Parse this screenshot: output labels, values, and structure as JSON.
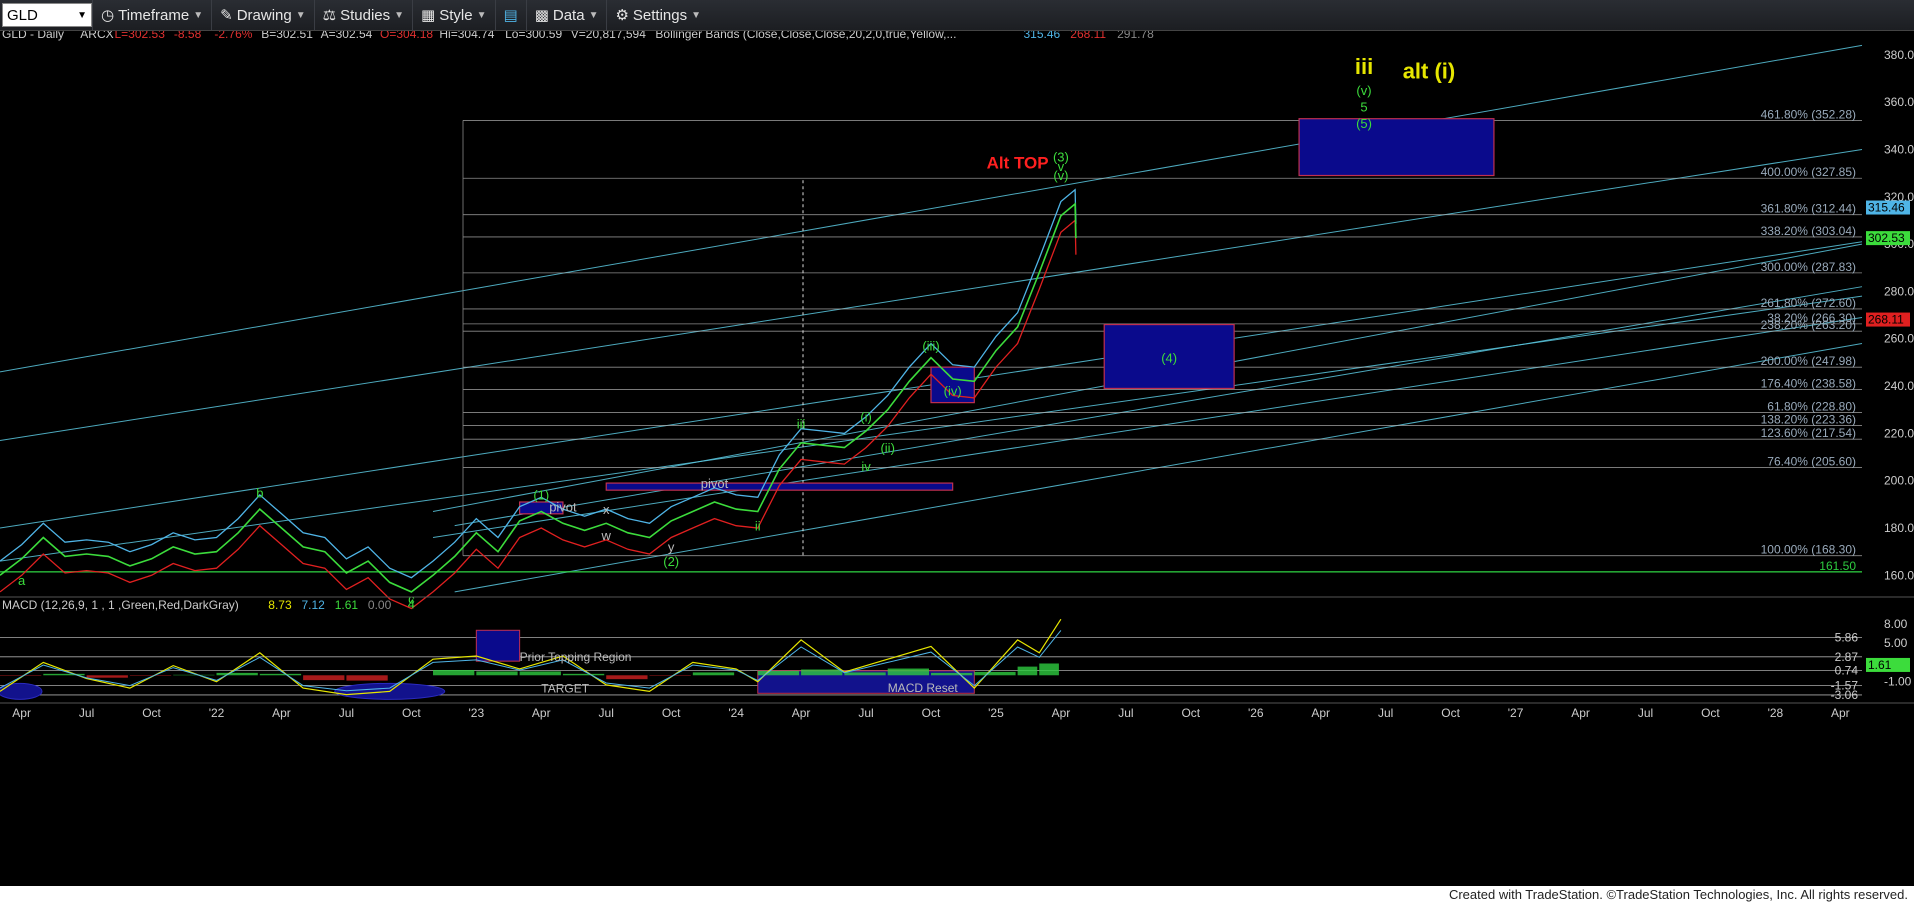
{
  "toolbar": {
    "symbol": "GLD",
    "timeframe": "Timeframe",
    "drawing": "Drawing",
    "studies": "Studies",
    "style": "Style",
    "data": "Data",
    "settings": "Settings"
  },
  "header": {
    "name": "GLD - Daily",
    "exchange": "ARCX",
    "last": "L=302.53",
    "change": "-8.58",
    "pct": "-2.76%",
    "bid": "B=302.51",
    "ask": "A=302.54",
    "open": "O=304.18",
    "high": "Hi=304.74",
    "low": "Lo=300.59",
    "volume": "V=20,817,594",
    "study": "Bollinger Bands (Close,Close,Close,20,2,0,true,Yellow,...",
    "bb_upper": "315.46",
    "bb_lower": "268.11",
    "bb_mid": "291.78"
  },
  "macd_header": {
    "label": "MACD (12,26,9, 1 , 1 ,Green,Red,DarkGray)",
    "v1": "8.73",
    "v2": "7.12",
    "v3": "1.61",
    "v4": "0.00"
  },
  "footer": "Created with TradeStation. ©TradeStation Technologies, Inc. All rights reserved.",
  "colors": {
    "price": "#3cdc3c",
    "bb_upper": "#4fb4e6",
    "bb_lower": "#e02020",
    "channel": "#5bc8e0",
    "fib": "#b0b0b0",
    "box": "#0a0a8c",
    "wave_green": "#3cdc3c",
    "wave_yellow": "#e6e600",
    "alt_top": "#ff2020"
  },
  "chart_data": {
    "type": "line",
    "symbol": "GLD",
    "price_axis": {
      "ylim": [
        150,
        385
      ],
      "ticks": [
        160,
        180,
        200,
        220,
        240,
        260,
        280,
        300,
        320,
        340,
        360,
        380
      ]
    },
    "time_axis": {
      "labels": [
        "Apr",
        "Jul",
        "Oct",
        "'22",
        "Apr",
        "Jul",
        "Oct",
        "'23",
        "Apr",
        "Jul",
        "Oct",
        "'24",
        "Apr",
        "Jul",
        "Oct",
        "'25",
        "Apr",
        "Jul",
        "Oct",
        "'26",
        "Apr",
        "Jul",
        "Oct",
        "'27",
        "Apr",
        "Jul",
        "Oct",
        "'28",
        "Apr"
      ],
      "start": "2021-03",
      "end": "2028-05"
    },
    "price_series": [
      [
        "2021-03",
        160
      ],
      [
        "2021-04",
        167
      ],
      [
        "2021-05",
        176
      ],
      [
        "2021-06",
        168
      ],
      [
        "2021-07",
        169
      ],
      [
        "2021-08",
        168
      ],
      [
        "2021-09",
        164
      ],
      [
        "2021-10",
        167
      ],
      [
        "2021-11",
        172
      ],
      [
        "2021-12",
        169
      ],
      [
        "2022-01",
        170
      ],
      [
        "2022-02",
        178
      ],
      [
        "2022-03",
        188
      ],
      [
        "2022-04",
        180
      ],
      [
        "2022-05",
        172
      ],
      [
        "2022-06",
        170
      ],
      [
        "2022-07",
        161
      ],
      [
        "2022-08",
        166
      ],
      [
        "2022-09",
        157
      ],
      [
        "2022-10",
        153
      ],
      [
        "2022-11",
        160
      ],
      [
        "2022-12",
        168
      ],
      [
        "2023-01",
        178
      ],
      [
        "2023-02",
        170
      ],
      [
        "2023-03",
        183
      ],
      [
        "2023-04",
        187
      ],
      [
        "2023-05",
        182
      ],
      [
        "2023-06",
        179
      ],
      [
        "2023-07",
        182
      ],
      [
        "2023-08",
        178
      ],
      [
        "2023-09",
        176
      ],
      [
        "2023-10",
        183
      ],
      [
        "2023-11",
        187
      ],
      [
        "2023-12",
        191
      ],
      [
        "2024-01",
        188
      ],
      [
        "2024-02",
        187
      ],
      [
        "2024-03",
        205
      ],
      [
        "2024-04",
        216
      ],
      [
        "2024-05",
        215
      ],
      [
        "2024-06",
        214
      ],
      [
        "2024-07",
        221
      ],
      [
        "2024-08",
        230
      ],
      [
        "2024-09",
        242
      ],
      [
        "2024-10",
        252
      ],
      [
        "2024-11",
        243
      ],
      [
        "2024-12",
        242
      ],
      [
        "2025-01",
        255
      ],
      [
        "2025-02",
        265
      ],
      [
        "2025-03",
        288
      ],
      [
        "2025-04",
        312
      ],
      [
        "2025-04-21",
        317
      ],
      [
        "2025-04-22",
        302.53
      ]
    ],
    "fib_levels": [
      {
        "label": "461.80% (352.28)",
        "value": 352.28
      },
      {
        "label": "400.00% (327.85)",
        "value": 327.85
      },
      {
        "label": "361.80% (312.44)",
        "value": 312.44
      },
      {
        "label": "338.20% (303.04)",
        "value": 303.04
      },
      {
        "label": "300.00% (287.83)",
        "value": 287.83
      },
      {
        "label": "261.80% (272.60)",
        "value": 272.6
      },
      {
        "label": "38.20% (266.30)",
        "value": 266.3
      },
      {
        "label": "238.20% (263.20)",
        "value": 263.2
      },
      {
        "label": "200.00% (247.98)",
        "value": 247.98
      },
      {
        "label": "176.40% (238.58)",
        "value": 238.58
      },
      {
        "label": "61.80% (228.80)",
        "value": 228.8
      },
      {
        "label": "138.20% (223.36)",
        "value": 223.36
      },
      {
        "label": "123.60% (217.54)",
        "value": 217.54
      },
      {
        "label": "76.40% (205.60)",
        "value": 205.6
      },
      {
        "label": "100.00% (168.30)",
        "value": 168.3
      },
      {
        "label": "161.50",
        "value": 161.5
      }
    ],
    "price_tags": [
      {
        "label": "315.46",
        "value": 315.46,
        "kind": "bb_upper"
      },
      {
        "label": "302.53",
        "value": 302.53,
        "kind": "last"
      },
      {
        "label": "268.11",
        "value": 268.11,
        "kind": "bb_lower"
      }
    ],
    "boxes": [
      {
        "name": "target-box-top",
        "from": "2026-03",
        "to": "2026-12",
        "low": 329,
        "high": 353
      },
      {
        "name": "wave-4-box",
        "from": "2025-06",
        "to": "2025-12",
        "low": 239,
        "high": 266
      },
      {
        "name": "pivot-box-1",
        "from": "2023-07",
        "to": "2024-11",
        "low": 196,
        "high": 199
      },
      {
        "name": "iv-box",
        "from": "2024-10",
        "to": "2024-12",
        "low": 233,
        "high": 248
      },
      {
        "name": "pivot-box-2",
        "from": "2023-03",
        "to": "2023-05",
        "low": 186,
        "high": 191
      }
    ],
    "wave_labels": [
      {
        "text": "a",
        "date": "2021-04",
        "price": 156,
        "color": "wave_green"
      },
      {
        "text": "b",
        "date": "2022-03",
        "price": 193,
        "color": "wave_green"
      },
      {
        "text": "c",
        "date": "2022-10",
        "price": 148,
        "color": "wave_green"
      },
      {
        "text": "4",
        "date": "2022-10",
        "price": 146,
        "color": "wave_green"
      },
      {
        "text": "(1)",
        "date": "2023-04",
        "price": 192,
        "color": "wave_green"
      },
      {
        "text": "pivot",
        "date": "2023-05",
        "price": 187,
        "color": "wave_grey"
      },
      {
        "text": "x",
        "date": "2023-07",
        "price": 186,
        "color": "wave_grey"
      },
      {
        "text": "w",
        "date": "2023-07",
        "price": 175,
        "color": "wave_grey"
      },
      {
        "text": "y",
        "date": "2023-10",
        "price": 170,
        "color": "wave_grey"
      },
      {
        "text": "(2)",
        "date": "2023-10",
        "price": 164,
        "color": "wave_green"
      },
      {
        "text": "pivot",
        "date": "2023-12",
        "price": 197,
        "color": "wave_grey"
      },
      {
        "text": "ii",
        "date": "2024-02",
        "price": 179,
        "color": "wave_green"
      },
      {
        "text": "iii",
        "date": "2024-04",
        "price": 222,
        "color": "wave_green"
      },
      {
        "text": "iv",
        "date": "2024-07",
        "price": 204,
        "color": "wave_green"
      },
      {
        "text": "(i)",
        "date": "2024-07",
        "price": 225,
        "color": "wave_green"
      },
      {
        "text": "(ii)",
        "date": "2024-08",
        "price": 212,
        "color": "wave_green"
      },
      {
        "text": "(iii)",
        "date": "2024-10",
        "price": 255,
        "color": "wave_green"
      },
      {
        "text": "(iv)",
        "date": "2024-11",
        "price": 236,
        "color": "wave_green"
      },
      {
        "text": "(3)",
        "date": "2025-04",
        "price": 335,
        "color": "wave_green"
      },
      {
        "text": "v",
        "date": "2025-04",
        "price": 331,
        "color": "wave_green"
      },
      {
        "text": "(v)",
        "date": "2025-04",
        "price": 327,
        "color": "wave_green"
      },
      {
        "text": "(4)",
        "date": "2025-09",
        "price": 250,
        "color": "wave_green"
      },
      {
        "text": "(5)",
        "date": "2026-06",
        "price": 349,
        "color": "wave_green"
      },
      {
        "text": "Alt TOP",
        "date": "2025-02",
        "price": 332,
        "color": "alt_top"
      },
      {
        "text": "iii",
        "date": "2026-06",
        "price": 372,
        "color": "wave_yellow"
      },
      {
        "text": "(v)",
        "date": "2026-06",
        "price": 363,
        "color": "wave_green"
      },
      {
        "text": "5",
        "date": "2026-06",
        "price": 356,
        "color": "wave_green"
      },
      {
        "text": "alt (i)",
        "date": "2026-09",
        "price": 370,
        "color": "wave_yellow"
      }
    ],
    "macd": {
      "ylim": [
        -4,
        10
      ],
      "ticks": [
        8.0,
        5.0,
        -1.0
      ],
      "levels": [
        {
          "label": "5.86",
          "value": 5.86
        },
        {
          "label": "2.87",
          "value": 2.87
        },
        {
          "label": "0.74",
          "value": 0.74
        },
        {
          "label": "-1.57",
          "value": -1.57
        },
        {
          "label": "-3.06",
          "value": -3.06
        }
      ],
      "tags": [
        {
          "label": "1.61",
          "value": 1.61
        }
      ],
      "annotations": [
        {
          "text": "Prior Topping Region",
          "date": "2023-03",
          "value": 2.2
        },
        {
          "text": "TARGET",
          "date": "2023-04",
          "value": -2.7
        },
        {
          "text": "MACD Reset",
          "date": "2024-08",
          "value": -2.6
        }
      ],
      "series": [
        [
          "2021-03",
          -2.5
        ],
        [
          "2021-05",
          2
        ],
        [
          "2021-07",
          -0.5
        ],
        [
          "2021-09",
          -2
        ],
        [
          "2021-11",
          1.5
        ],
        [
          "2022-01",
          -1
        ],
        [
          "2022-03",
          3.5
        ],
        [
          "2022-05",
          -2
        ],
        [
          "2022-07",
          -3
        ],
        [
          "2022-09",
          -2.5
        ],
        [
          "2022-11",
          2.5
        ],
        [
          "2023-01",
          3
        ],
        [
          "2023-03",
          1
        ],
        [
          "2023-05",
          3
        ],
        [
          "2023-07",
          -1.5
        ],
        [
          "2023-09",
          -2.5
        ],
        [
          "2023-11",
          2
        ],
        [
          "2024-01",
          1
        ],
        [
          "2024-02",
          -1
        ],
        [
          "2024-04",
          5.5
        ],
        [
          "2024-06",
          0.5
        ],
        [
          "2024-08",
          2.5
        ],
        [
          "2024-10",
          4.5
        ],
        [
          "2024-12",
          -2
        ],
        [
          "2025-02",
          5.5
        ],
        [
          "2025-03",
          3.5
        ],
        [
          "2025-04",
          8.73
        ]
      ]
    }
  }
}
